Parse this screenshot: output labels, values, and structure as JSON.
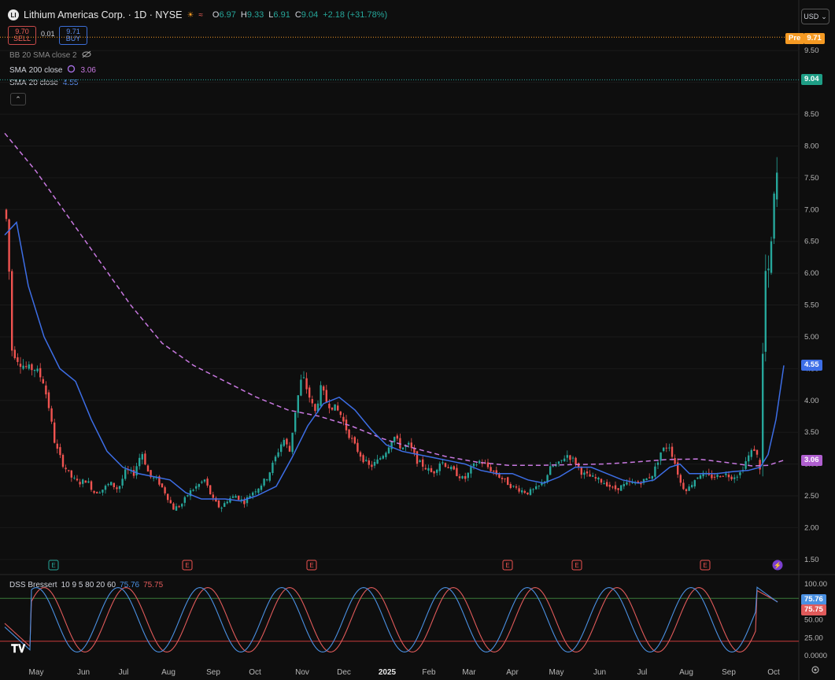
{
  "header": {
    "logo_text": "LI",
    "title": "Lithium Americas Corp. · 1D · NYSE",
    "open_label": "O",
    "open": "6.97",
    "high_label": "H",
    "high": "9.33",
    "low_label": "L",
    "low": "6.91",
    "close_label": "C",
    "close": "9.04",
    "change": "+2.18 (+31.78%)"
  },
  "trade": {
    "sell_price": "9.70",
    "sell_label": "SELL",
    "spread": "0.01",
    "buy_price": "9.71",
    "buy_label": "BUY"
  },
  "indicators": {
    "bb": "BB 20 SMA close 2",
    "sma200_name": "SMA",
    "sma200_params": "200 close",
    "sma200_value": "3.06",
    "sma20_name": "SMA",
    "sma20_params": "20 close",
    "sma20_value": "4.55"
  },
  "currency": "USD",
  "price_labels": {
    "pre_tag": "Pre",
    "pre_value": "9.71",
    "last": "9.04",
    "sma20": "4.55",
    "sma200": "3.06"
  },
  "oscillator": {
    "name": "DSS Bressert",
    "params": "10 9 5 80 20 60",
    "k_value": "75.76",
    "d_value": "75.75",
    "k_label": "75.76",
    "d_label": "75.75",
    "upper_band": 80,
    "lower_band": 20
  },
  "colors": {
    "up": "#26a69a",
    "down": "#ef5350",
    "sma20": "#3d6ee6",
    "sma200": "#c878e0",
    "pre": "#f59a23",
    "osc_k": "#4a90e2",
    "osc_d": "#e05a5a"
  },
  "events": [
    "E",
    "E",
    "E",
    "E",
    "E",
    "E",
    "⚡"
  ],
  "chart_data": {
    "type": "candlestick",
    "title": "Lithium Americas Corp. · 1D · NYSE",
    "x_ticks": [
      "May",
      "Jun",
      "Jul",
      "Aug",
      "Sep",
      "Oct",
      "Nov",
      "Dec",
      "2025",
      "Feb",
      "Mar",
      "Apr",
      "May",
      "Jun",
      "Jul",
      "Aug",
      "Sep",
      "Oct"
    ],
    "y_ticks": [
      "9.50",
      "9.00",
      "8.50",
      "8.00",
      "7.50",
      "7.00",
      "6.50",
      "6.00",
      "5.50",
      "5.00",
      "4.50",
      "4.00",
      "3.50",
      "3.00",
      "2.50",
      "2.00",
      "1.50"
    ],
    "ylim": [
      1.3,
      9.8
    ],
    "osc_ticks": [
      "100.00",
      "75.00",
      "50.00",
      "25.00",
      "0.0000"
    ],
    "osc_ylim": [
      0,
      100
    ],
    "anchors": [
      [
        0,
        7.0
      ],
      [
        5,
        7.2
      ],
      [
        10,
        6.6
      ],
      [
        15,
        4.8
      ],
      [
        25,
        4.6
      ],
      [
        35,
        4.5
      ],
      [
        45,
        4.5
      ],
      [
        55,
        4.3
      ],
      [
        62,
        3.9
      ],
      [
        70,
        3.3
      ],
      [
        80,
        3.0
      ],
      [
        90,
        2.8
      ],
      [
        100,
        2.7
      ],
      [
        110,
        2.75
      ],
      [
        120,
        2.55
      ],
      [
        130,
        2.6
      ],
      [
        140,
        2.7
      ],
      [
        150,
        2.6
      ],
      [
        160,
        2.9
      ],
      [
        170,
        2.85
      ],
      [
        180,
        3.2
      ],
      [
        190,
        2.8
      ],
      [
        200,
        2.75
      ],
      [
        210,
        2.55
      ],
      [
        220,
        2.3
      ],
      [
        230,
        2.35
      ],
      [
        240,
        2.55
      ],
      [
        250,
        2.65
      ],
      [
        260,
        2.75
      ],
      [
        270,
        2.45
      ],
      [
        280,
        2.3
      ],
      [
        290,
        2.45
      ],
      [
        300,
        2.5
      ],
      [
        310,
        2.4
      ],
      [
        320,
        2.55
      ],
      [
        330,
        2.65
      ],
      [
        340,
        2.8
      ],
      [
        350,
        3.1
      ],
      [
        360,
        3.4
      ],
      [
        368,
        3.2
      ],
      [
        376,
        3.9
      ],
      [
        384,
        4.4
      ],
      [
        392,
        4.1
      ],
      [
        400,
        3.8
      ],
      [
        408,
        4.2
      ],
      [
        416,
        3.95
      ],
      [
        424,
        3.9
      ],
      [
        432,
        3.8
      ],
      [
        440,
        3.55
      ],
      [
        450,
        3.3
      ],
      [
        460,
        3.1
      ],
      [
        470,
        2.95
      ],
      [
        480,
        3.05
      ],
      [
        490,
        3.2
      ],
      [
        500,
        3.45
      ],
      [
        510,
        3.25
      ],
      [
        520,
        3.3
      ],
      [
        530,
        3.05
      ],
      [
        540,
        2.95
      ],
      [
        550,
        2.85
      ],
      [
        560,
        3.05
      ],
      [
        570,
        2.95
      ],
      [
        580,
        2.85
      ],
      [
        590,
        2.75
      ],
      [
        600,
        2.95
      ],
      [
        610,
        3.05
      ],
      [
        620,
        2.95
      ],
      [
        630,
        2.85
      ],
      [
        640,
        2.75
      ],
      [
        650,
        2.65
      ],
      [
        660,
        2.6
      ],
      [
        670,
        2.55
      ],
      [
        680,
        2.6
      ],
      [
        690,
        2.7
      ],
      [
        700,
        2.95
      ],
      [
        710,
        3.0
      ],
      [
        720,
        3.15
      ],
      [
        730,
        3.05
      ],
      [
        740,
        2.85
      ],
      [
        750,
        2.8
      ],
      [
        760,
        2.75
      ],
      [
        770,
        2.7
      ],
      [
        780,
        2.6
      ],
      [
        790,
        2.65
      ],
      [
        800,
        2.7
      ],
      [
        810,
        2.7
      ],
      [
        820,
        2.75
      ],
      [
        830,
        2.85
      ],
      [
        840,
        3.2
      ],
      [
        850,
        3.3
      ],
      [
        858,
        3.0
      ],
      [
        866,
        2.65
      ],
      [
        874,
        2.6
      ],
      [
        882,
        2.75
      ],
      [
        890,
        2.85
      ],
      [
        900,
        2.8
      ],
      [
        910,
        2.8
      ],
      [
        920,
        2.85
      ],
      [
        930,
        2.8
      ],
      [
        940,
        2.85
      ],
      [
        950,
        3.1
      ],
      [
        958,
        3.25
      ],
      [
        966,
        3.0
      ],
      [
        970,
        5.1
      ],
      [
        974,
        6.4
      ],
      [
        978,
        5.6
      ],
      [
        982,
        7.3
      ],
      [
        986,
        6.9
      ],
      [
        990,
        9.04
      ]
    ],
    "sma20_anchors": [
      [
        0,
        6.6
      ],
      [
        15,
        6.8
      ],
      [
        30,
        5.8
      ],
      [
        50,
        5.0
      ],
      [
        70,
        4.5
      ],
      [
        90,
        4.3
      ],
      [
        110,
        3.7
      ],
      [
        130,
        3.2
      ],
      [
        150,
        2.95
      ],
      [
        170,
        2.85
      ],
      [
        190,
        2.8
      ],
      [
        210,
        2.75
      ],
      [
        230,
        2.55
      ],
      [
        250,
        2.45
      ],
      [
        280,
        2.45
      ],
      [
        300,
        2.42
      ],
      [
        320,
        2.5
      ],
      [
        345,
        2.65
      ],
      [
        365,
        3.1
      ],
      [
        385,
        3.6
      ],
      [
        405,
        3.95
      ],
      [
        425,
        4.05
      ],
      [
        445,
        3.85
      ],
      [
        465,
        3.55
      ],
      [
        485,
        3.3
      ],
      [
        505,
        3.2
      ],
      [
        525,
        3.15
      ],
      [
        545,
        3.1
      ],
      [
        565,
        3.05
      ],
      [
        585,
        3.0
      ],
      [
        605,
        2.9
      ],
      [
        625,
        2.85
      ],
      [
        645,
        2.85
      ],
      [
        665,
        2.75
      ],
      [
        685,
        2.7
      ],
      [
        705,
        2.8
      ],
      [
        725,
        2.95
      ],
      [
        745,
        2.95
      ],
      [
        765,
        2.85
      ],
      [
        785,
        2.75
      ],
      [
        805,
        2.7
      ],
      [
        825,
        2.75
      ],
      [
        845,
        2.95
      ],
      [
        858,
        3.0
      ],
      [
        870,
        2.85
      ],
      [
        885,
        2.85
      ],
      [
        905,
        2.85
      ],
      [
        925,
        2.88
      ],
      [
        945,
        2.9
      ],
      [
        960,
        2.95
      ],
      [
        970,
        3.15
      ],
      [
        980,
        3.7
      ],
      [
        990,
        4.55
      ]
    ],
    "sma200_anchors": [
      [
        0,
        8.2
      ],
      [
        40,
        7.6
      ],
      [
        80,
        6.9
      ],
      [
        120,
        6.2
      ],
      [
        160,
        5.5
      ],
      [
        200,
        4.9
      ],
      [
        240,
        4.55
      ],
      [
        280,
        4.3
      ],
      [
        320,
        4.05
      ],
      [
        360,
        3.85
      ],
      [
        400,
        3.75
      ],
      [
        440,
        3.6
      ],
      [
        480,
        3.4
      ],
      [
        520,
        3.25
      ],
      [
        560,
        3.12
      ],
      [
        600,
        3.03
      ],
      [
        640,
        2.98
      ],
      [
        680,
        2.98
      ],
      [
        720,
        2.99
      ],
      [
        760,
        3.0
      ],
      [
        800,
        3.03
      ],
      [
        840,
        3.07
      ],
      [
        880,
        3.08
      ],
      [
        920,
        3.02
      ],
      [
        950,
        2.97
      ],
      [
        970,
        2.98
      ],
      [
        990,
        3.06
      ]
    ]
  }
}
